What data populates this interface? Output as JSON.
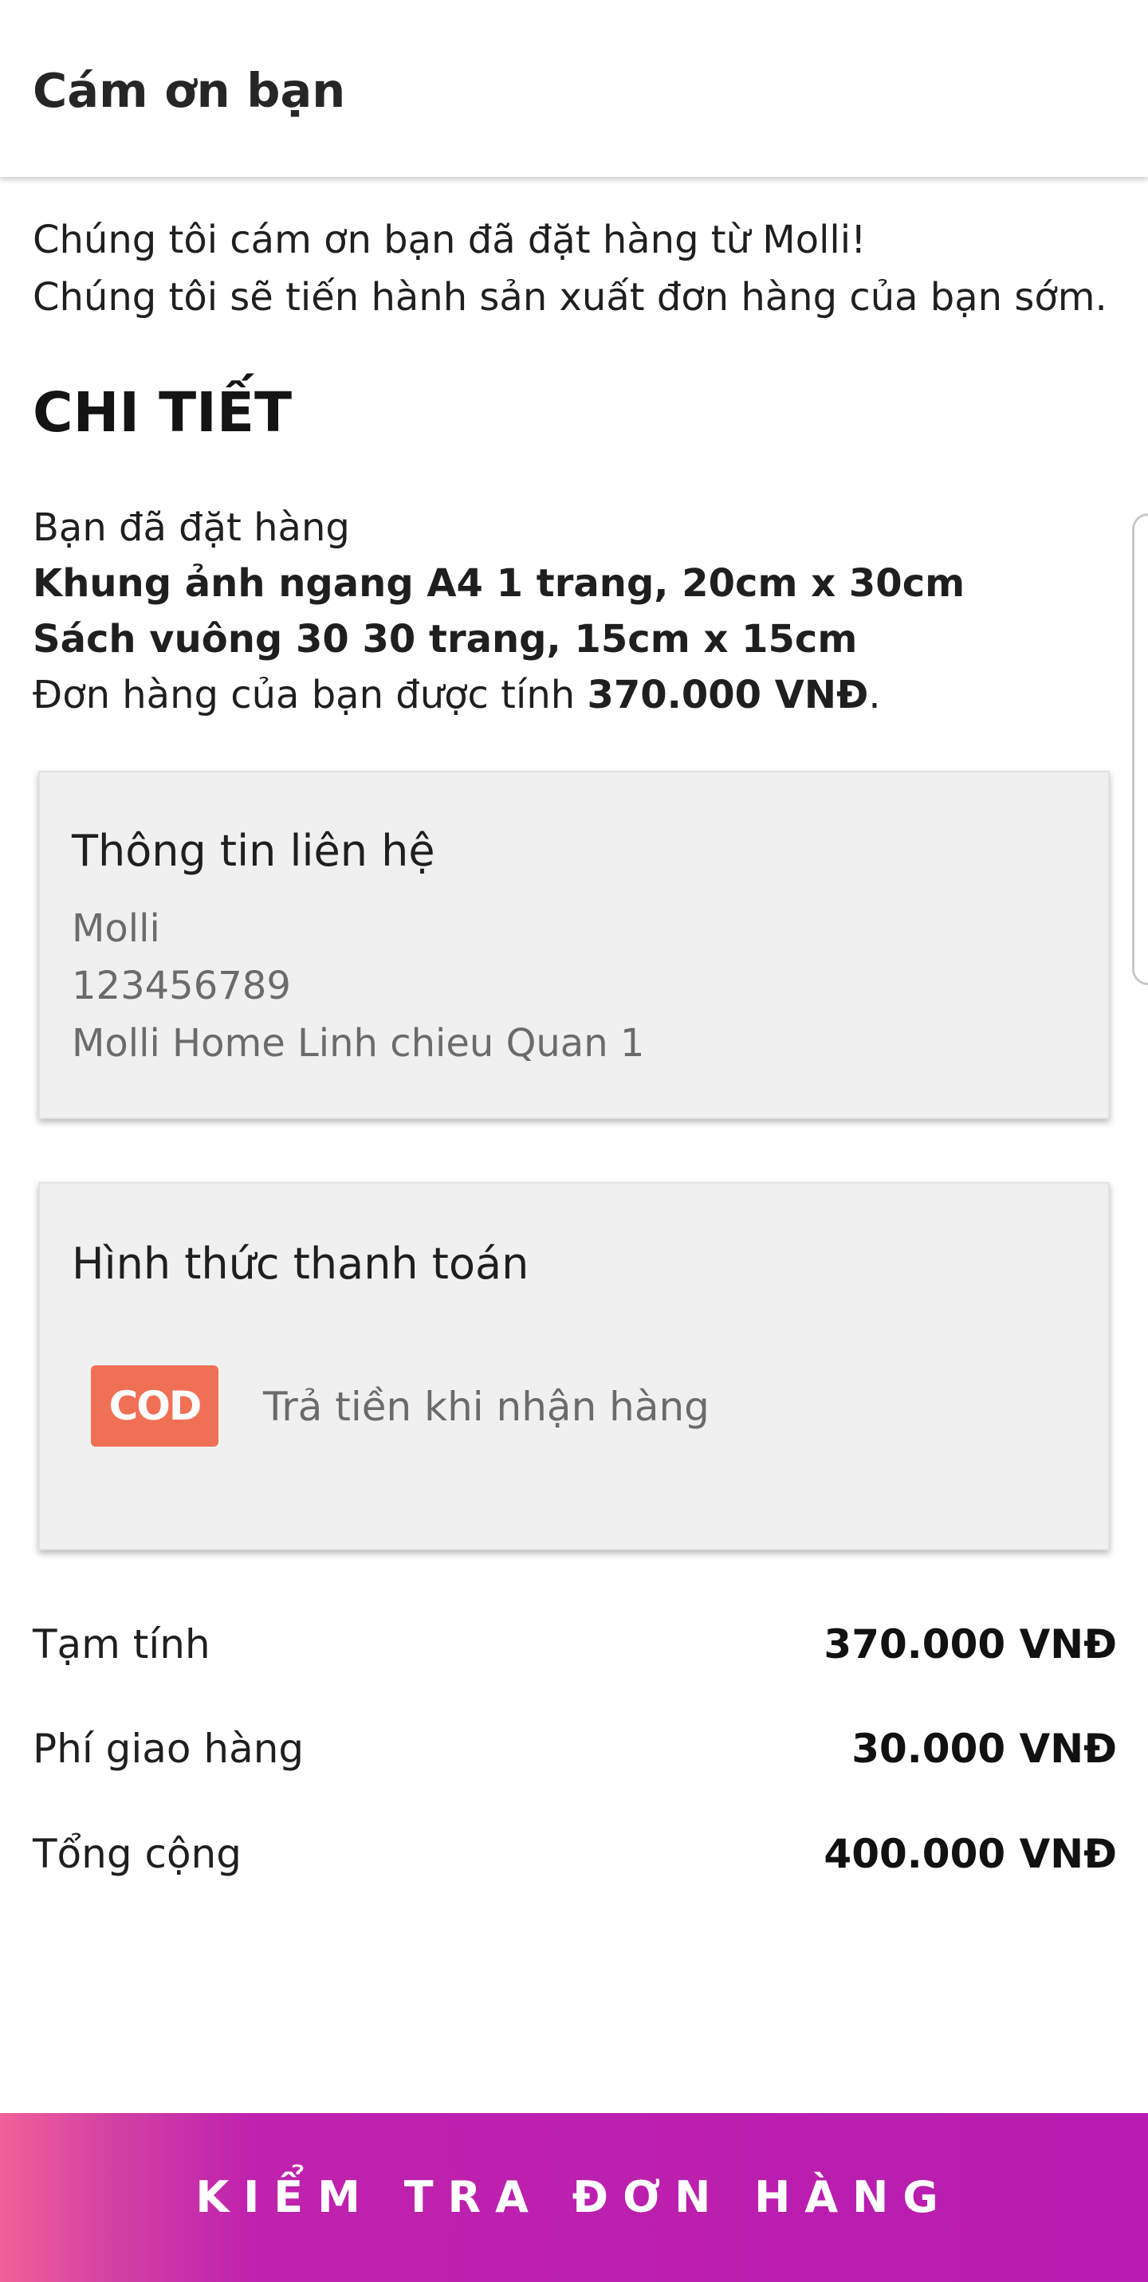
{
  "header": {
    "title": "Cám ơn bạn"
  },
  "intro": {
    "line1": "Chúng tôi cám ơn bạn đã đặt hàng từ Molli!",
    "line2": "Chúng tôi sẽ tiến hành sản xuất đơn hàng của bạn sớm."
  },
  "details": {
    "heading": "CHI TIẾT",
    "ordered_label": "Bạn đã đặt hàng",
    "items": [
      "Khung ảnh ngang A4 1 trang, 20cm x 30cm",
      "Sách vuông 30 30 trang, 15cm x 15cm"
    ],
    "price_prefix": "Đơn hàng của bạn được tính ",
    "price_value": "370.000 VNĐ",
    "price_suffix": "."
  },
  "contact": {
    "title": "Thông tin liên hệ",
    "name": "Molli",
    "phone": "123456789",
    "address": "Molli Home Linh chieu Quan 1"
  },
  "payment": {
    "title": "Hình thức thanh toán",
    "badge": "COD",
    "method": "Trả tiền khi nhận hàng",
    "badge_color": "#f07055"
  },
  "summary": [
    {
      "label": "Tạm tính",
      "value": "370.000 VNĐ"
    },
    {
      "label": "Phí giao hàng",
      "value": "30.000 VNĐ"
    },
    {
      "label": "Tổng cộng",
      "value": "400.000 VNĐ"
    }
  ],
  "cta": {
    "label": "KIỂM TRA ĐƠN HÀNG",
    "gradient_start": "#f2609a",
    "gradient_end": "#b81cb0"
  }
}
